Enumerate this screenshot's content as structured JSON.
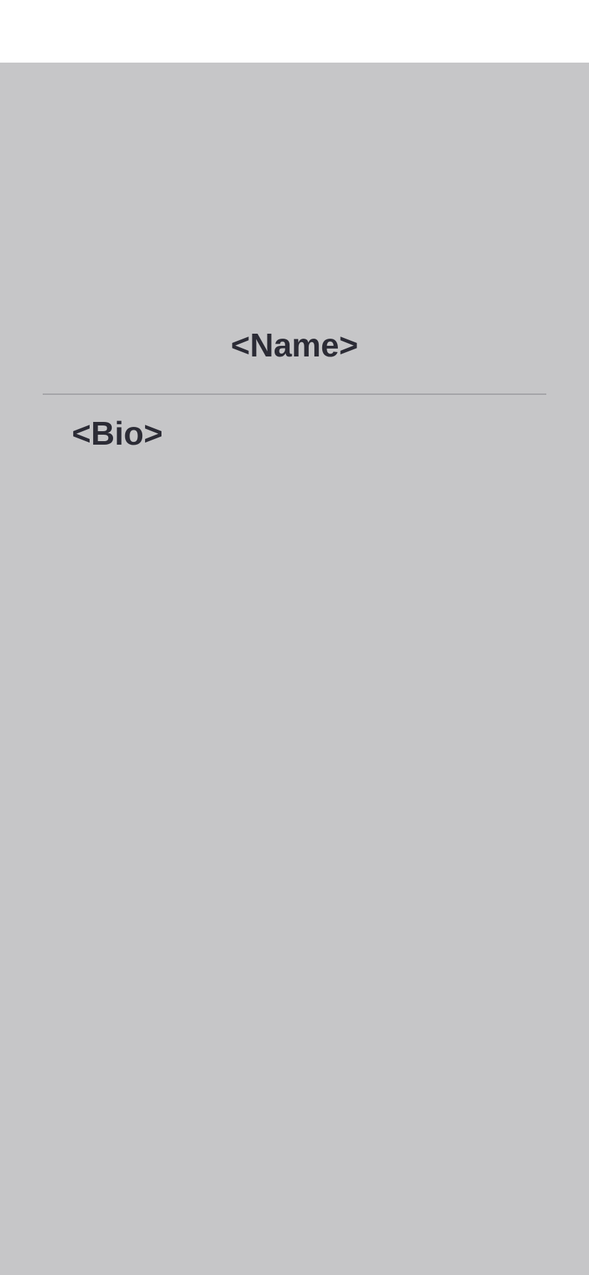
{
  "profile": {
    "name": "<Name>",
    "bio": "<Bio>"
  },
  "colors": {
    "background": "#c6c6c8",
    "status_bar": "#ffffff",
    "text": "#2c2c36",
    "divider": "#a3a3a7"
  }
}
